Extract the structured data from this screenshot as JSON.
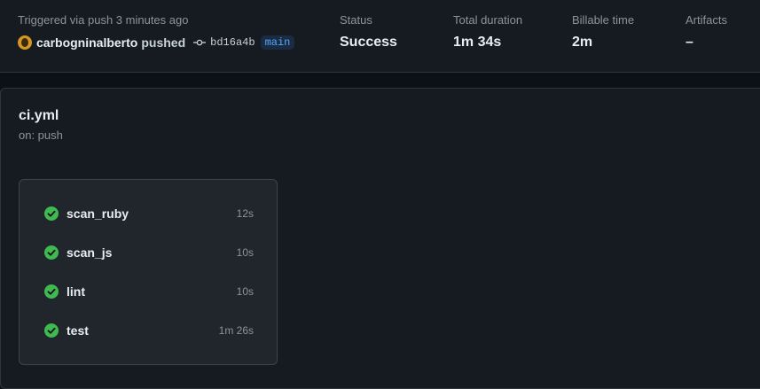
{
  "summary": {
    "trigger_text": "Triggered via push 3 minutes ago",
    "actor": "carbogninalberto",
    "action": "pushed",
    "commit_sha": "bd16a4b",
    "branch": "main",
    "status": {
      "label": "Status",
      "value": "Success"
    },
    "duration": {
      "label": "Total duration",
      "value": "1m 34s"
    },
    "billable": {
      "label": "Billable time",
      "value": "2m"
    },
    "artifacts": {
      "label": "Artifacts",
      "value": "–"
    }
  },
  "workflow": {
    "file": "ci.yml",
    "trigger": "on: push"
  },
  "jobs": [
    {
      "name": "scan_ruby",
      "duration": "12s",
      "status": "success"
    },
    {
      "name": "scan_js",
      "duration": "10s",
      "status": "success"
    },
    {
      "name": "lint",
      "duration": "10s",
      "status": "success"
    },
    {
      "name": "test",
      "duration": "1m 26s",
      "status": "success"
    }
  ],
  "colors": {
    "success": "#3fb950",
    "link": "#58a6ff",
    "background": "#0d1117",
    "surface": "#161b22"
  },
  "icons": {
    "avatar": "user-avatar",
    "commit": "git-commit-icon",
    "job_status": "check-circle-icon"
  }
}
